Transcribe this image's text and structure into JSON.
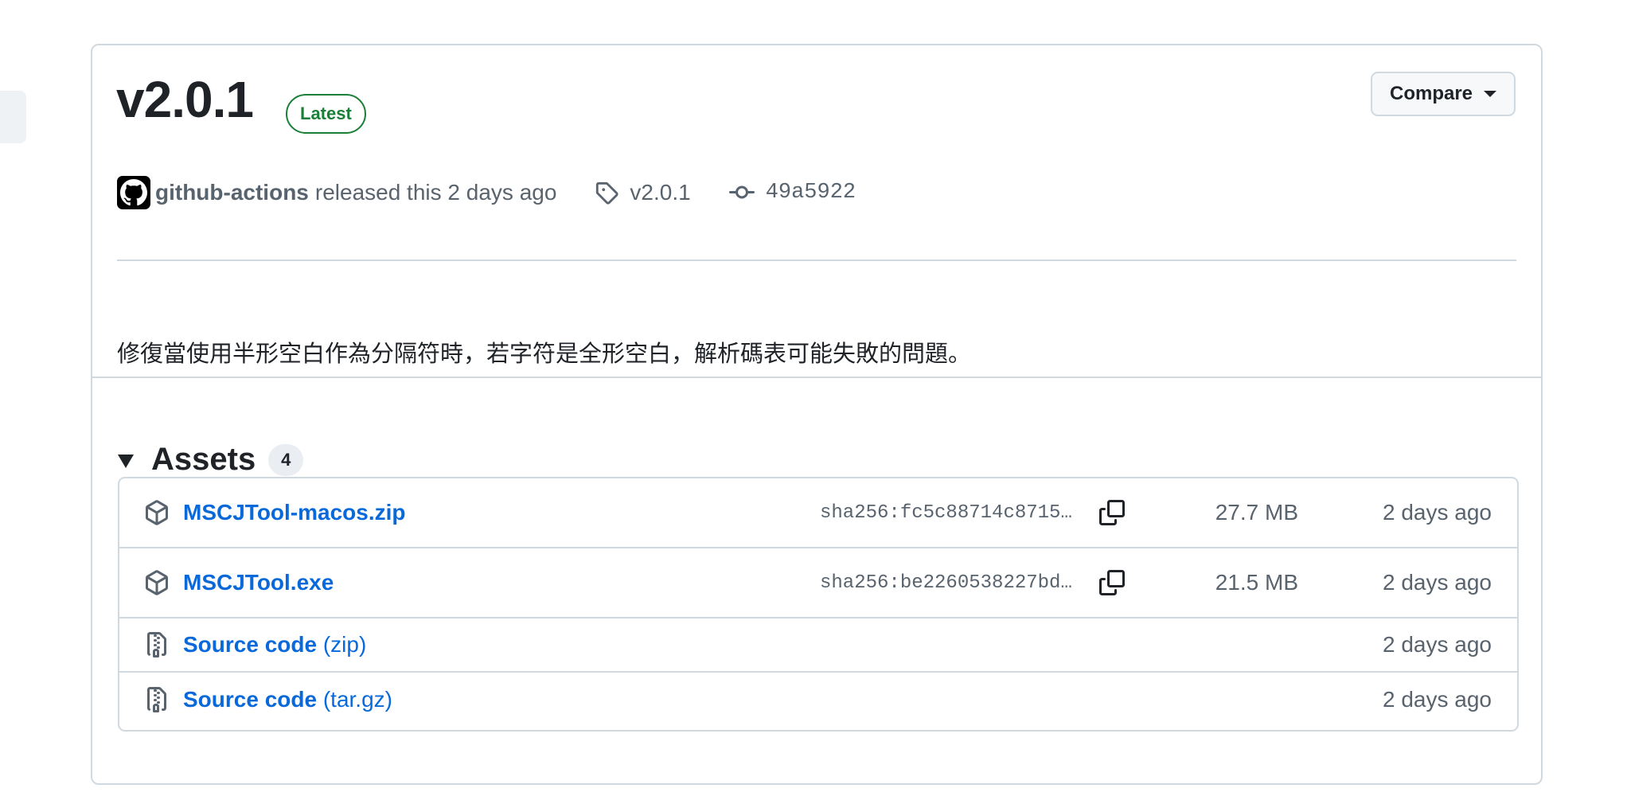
{
  "release": {
    "version": "v2.0.1",
    "badge": "Latest",
    "compare_label": "Compare",
    "actor": "github-actions",
    "released_text": "released this 2 days ago",
    "tag": "v2.0.1",
    "commit": "49a5922",
    "description": "修復當使用半形空白作為分隔符時，若字符是全形空白，解析碼表可能失敗的問題。"
  },
  "assets": {
    "title": "Assets",
    "count": "4",
    "items": [
      {
        "name": "MSCJTool-macos.zip",
        "ext": "",
        "sha": "sha256:fc5c88714c8715…",
        "size": "27.7 MB",
        "date": "2 days ago",
        "icon": "package-icon"
      },
      {
        "name": "MSCJTool.exe",
        "ext": "",
        "sha": "sha256:be2260538227bd…",
        "size": "21.5 MB",
        "date": "2 days ago",
        "icon": "package-icon"
      },
      {
        "name": "Source code",
        "ext": "(zip)",
        "sha": "",
        "size": "",
        "date": "2 days ago",
        "icon": "file-zip-icon"
      },
      {
        "name": "Source code",
        "ext": "(tar.gz)",
        "sha": "",
        "size": "",
        "date": "2 days ago",
        "icon": "file-zip-icon"
      }
    ]
  },
  "colors": {
    "accent_link": "#0969da",
    "latest_green": "#1a7f37",
    "border": "#d1d9e0",
    "muted_text": "#59636e"
  }
}
